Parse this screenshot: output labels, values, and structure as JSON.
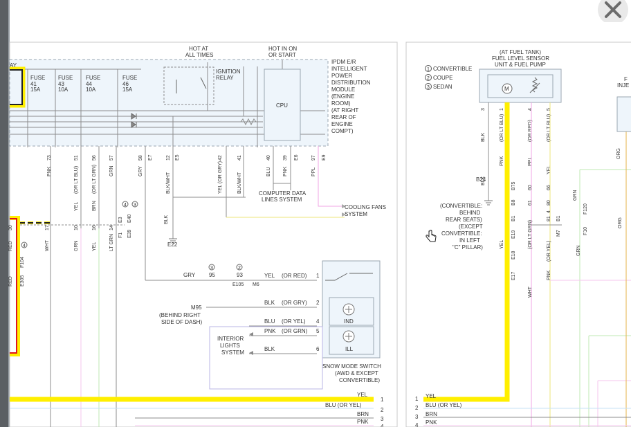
{
  "colors": {
    "highlight": "#ffef00",
    "highlight_red": "#e0141e",
    "wire": "#8c8c8c",
    "panel": "#eef5fb",
    "panel_border": "#9aa6b2",
    "pink_wire": "#f2a6e6",
    "green_wire": "#bfe9b3"
  },
  "icons": {
    "close": "close-icon",
    "cursor": "hand-cursor-icon",
    "motor": "motor-icon"
  },
  "left": {
    "header_hot_always": [
      "HOT AT",
      "ALL TIMES"
    ],
    "header_hot_on": [
      "HOT IN ON",
      "OR START"
    ],
    "relay_label": "AY",
    "fuses": [
      {
        "name": "FUSE",
        "num": "41",
        "amp": "15A"
      },
      {
        "name": "FUSE",
        "num": "43",
        "amp": "10A"
      },
      {
        "name": "FUSE",
        "num": "44",
        "amp": "10A"
      },
      {
        "name": "FUSE",
        "num": "46",
        "amp": "15A"
      }
    ],
    "ignition_relay": [
      "IGNITION",
      "RELAY"
    ],
    "cpu": "CPU",
    "ipdm": [
      "IPDM E/R",
      "INTELLIGENT",
      "POWER",
      "DISTRIBUTION",
      "MODULE",
      "(ENGINE",
      "ROOM)",
      "(AT RIGHT",
      "REAR OF",
      "ENGINE",
      "COMPT)"
    ],
    "pins_row1": [
      {
        "wire": "PNK",
        "pin": "73"
      },
      {
        "wire": "(OR LT BLU)",
        "pin": "51"
      },
      {
        "wire": "(OR LT GRN)",
        "pin": "56"
      },
      {
        "wire": "GRN",
        "pin": "57"
      },
      {
        "wire": "GRY",
        "pin": "58"
      },
      {
        "wire": "",
        "pin": "E7"
      },
      {
        "wire": "BLK/WHT",
        "pin": "12"
      },
      {
        "wire": "",
        "pin": "E5"
      },
      {
        "wire": "YEL (OR GRY)",
        "pin": "42"
      },
      {
        "wire": "BLK/WHT",
        "pin": "41"
      },
      {
        "wire": "BLU",
        "pin": "40"
      },
      {
        "wire": "PNK",
        "pin": "39"
      },
      {
        "wire": "",
        "pin": "E6"
      },
      {
        "wire": "PPL",
        "pin": "97"
      },
      {
        "wire": "",
        "pin": "E9"
      }
    ],
    "computer_data": [
      "COMPUTER DATA",
      "LINES SYSTEM"
    ],
    "cooling_fans": [
      "COOLING FANS",
      "SYSTEM"
    ],
    "ground_e22": "E22",
    "blk_label": "BLK",
    "row2": [
      {
        "pin": "30",
        "wire": "RED"
      },
      {
        "pin": "17",
        "wire": "WHT"
      },
      {
        "pin": "10",
        "wire": "GRN"
      },
      {
        "pin": "16",
        "wire": "YEL"
      },
      {
        "pin": "14",
        "wire": "LT GRN"
      }
    ],
    "row2_top_wires": [
      "YEL",
      "BRN"
    ],
    "e3_labels": [
      "E3",
      "F1",
      "E39",
      "E40"
    ],
    "circle_nums": [
      "4",
      "3",
      "2",
      "3"
    ],
    "f104": "F104",
    "e305": "E305",
    "red2": "RED",
    "gry_row": {
      "wire": "GRY",
      "pin_a": "95",
      "pin_b": "93",
      "conn": "E105",
      "conn2": "M6"
    },
    "switch_rows": [
      {
        "wire_l": "YEL",
        "wire_r": "(OR RED)",
        "pin": "1"
      },
      {
        "wire_l": "BLK",
        "wire_r": "(OR GRY)",
        "pin": "2"
      },
      {
        "wire_l": "BLU",
        "wire_r": "(OR YEL)",
        "pin": "4"
      },
      {
        "wire_l": "PNK",
        "wire_r": "(OR GRN)",
        "pin": "5"
      },
      {
        "wire_l": "BLK",
        "wire_r": "",
        "pin": "6"
      }
    ],
    "m95": "M95",
    "m95_desc": [
      "(BEHIND RIGHT",
      "SIDE OF DASH)"
    ],
    "interior_lights": [
      "INTERIOR",
      "LIGHTS",
      "SYSTEM"
    ],
    "ind": "IND",
    "ill": "ILL",
    "snow_switch": [
      "SNOW MODE SWITCH",
      "(AWD & EXCEPT",
      "CONVERTIBLE)"
    ],
    "bottom_rows": [
      {
        "wire": "YEL",
        "pin": "1"
      },
      {
        "wire": "BLU (OR YEL)",
        "pin": "2"
      },
      {
        "wire": "BRN",
        "pin": "3"
      },
      {
        "wire": "PNK",
        "pin": "4"
      }
    ]
  },
  "right": {
    "legend": [
      {
        "num": "1",
        "label": "CONVERTIBLE"
      },
      {
        "num": "2",
        "label": "COUPE"
      },
      {
        "num": "3",
        "label": "SEDAN"
      }
    ],
    "sensor_title": [
      "(AT FUEL TANK)",
      "FUEL LEVEL SENSOR",
      "UNIT & FUEL PUMP"
    ],
    "motor": "M",
    "pins": [
      {
        "pin": "3",
        "wire": "BLK"
      },
      {
        "pin": "1",
        "wire": "(OR LT BLU)"
      },
      {
        "pin": "4",
        "wire": "(OR RED)"
      },
      {
        "pin": "5",
        "wire": "(OR LT BLU)"
      }
    ],
    "pnk": "PNK",
    "ppl": "PPL",
    "yel": "YEL",
    "blk2": "BLK",
    "b24": "B24",
    "b24_desc": [
      "(CONVERTIBLE:",
      "BEHIND",
      "REAR SEATS)",
      "(EXCEPT",
      "CONVERTIBLE:",
      "IN LEFT",
      "\"C\" PILLAR)"
    ],
    "conn_labels": [
      "B75",
      "B8",
      "B1",
      "60",
      "61",
      "66",
      "80",
      "81",
      "4",
      "B1",
      "M7"
    ],
    "e_labels": [
      "E19",
      "E18",
      "E17"
    ],
    "f_labels": [
      "F120",
      "F10"
    ],
    "lower_wires": [
      "YEL",
      "(OR LT GRN)",
      "(OR YEL)",
      "PNK",
      "WHT",
      "GRN",
      "GRN",
      "ORG",
      "ORG"
    ],
    "bottom_rows": [
      {
        "pin": "1",
        "wire": "YEL"
      },
      {
        "pin": "2",
        "wire": "BLU (OR YEL)"
      },
      {
        "pin": "3",
        "wire": "BRN"
      },
      {
        "pin": "4",
        "wire": "PNK"
      }
    ],
    "edge_partial": [
      "F",
      "INJE"
    ]
  }
}
